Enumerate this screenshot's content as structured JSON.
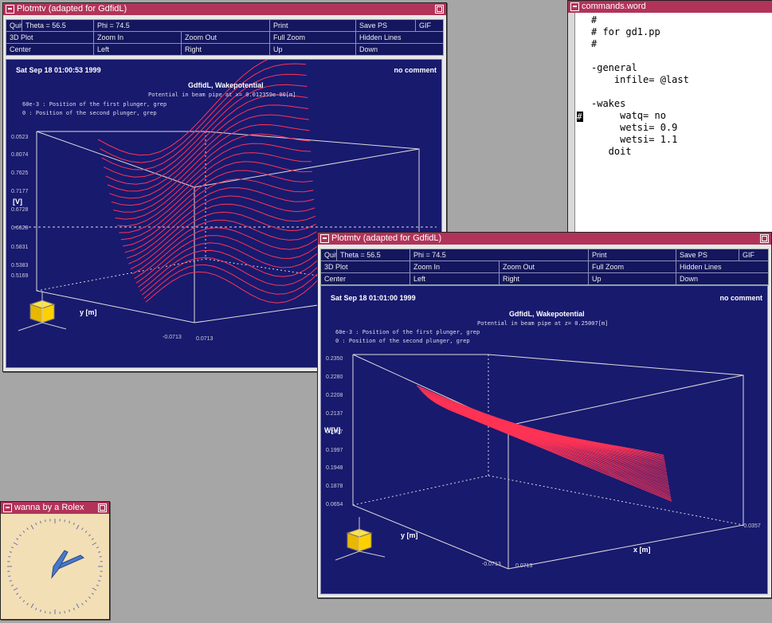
{
  "win1": {
    "title": "Plotmtv (adapted for GdfidL)",
    "menu": [
      [
        "Quit",
        "Theta = 56.5",
        "Phi = 74.5",
        "Print",
        "Save PS",
        "GIF"
      ],
      [
        "3D Plot",
        "Zoom In",
        "Zoom Out",
        "Full Zoom",
        "Hidden Lines"
      ],
      [
        "Center",
        "Left",
        "Right",
        "Up",
        "Down"
      ]
    ],
    "date": "Sat Sep 18 01:00:53 1999",
    "comment": "no comment",
    "plot_title": "GdfidL, Wakepotential",
    "plot_subtitle": "Potential in beam pipe at x= 0.012359e-00[m]",
    "legend1": "60e-3 : Position of the first plunger, grep",
    "legend2": "0 : Position of the second plunger, grep",
    "z_ticks": [
      "0.0523",
      "0.8074",
      "0.7625",
      "0.7177",
      "0.6728",
      "0.6628",
      "0.5831",
      "0.5383",
      "0.5169"
    ],
    "z_label": "[V]",
    "y_label": "y [m]",
    "x_tick_a": "-0.0713",
    "x_tick_b": "0.0713"
  },
  "term": {
    "title": "commands.word",
    "lines": [
      "#",
      "# for gd1.pp",
      "#",
      "",
      "-general",
      "    infile= @last",
      "",
      "-wakes",
      "     watq= no",
      "     wetsi= 0.9",
      "     wetsi= 1.1",
      "   doit"
    ],
    "cursor": "#"
  },
  "win2": {
    "title": "Plotmtv (adapted for GdfidL)",
    "menu": [
      [
        "Quit",
        "Theta = 56.5",
        "Phi = 74.5",
        "Print",
        "Save PS",
        "GIF"
      ],
      [
        "3D Plot",
        "Zoom In",
        "Zoom Out",
        "Full Zoom",
        "Hidden Lines"
      ],
      [
        "Center",
        "Left",
        "Right",
        "Up",
        "Down"
      ]
    ],
    "date": "Sat Sep 18 01:01:00 1999",
    "comment": "no comment",
    "plot_title": "GdfidL, Wakepotential",
    "plot_subtitle": "Potential in beam pipe at z= 0.25007[m]",
    "legend1": "60e-3 : Position of the first plunger, grep",
    "legend2": "0 : Position of the second plunger, grep",
    "z_ticks": [
      "0.2350",
      "0.2280",
      "0.2208",
      "0.2137",
      "0.2067",
      "0.1997",
      "0.1948",
      "0.1878",
      "0.0654"
    ],
    "z_label": "W[V]",
    "y_label": "y [m]",
    "x_label": "x [m]",
    "x_tick_a": "-0.0713",
    "x_tick_b": "0.0713",
    "x_tick_c": "-0.0357"
  },
  "clock": {
    "title": "wanna by a Rolex"
  },
  "colors": {
    "titlebar": "#b2335a",
    "canvas": "#181a6e",
    "curve": "#ff3355"
  }
}
